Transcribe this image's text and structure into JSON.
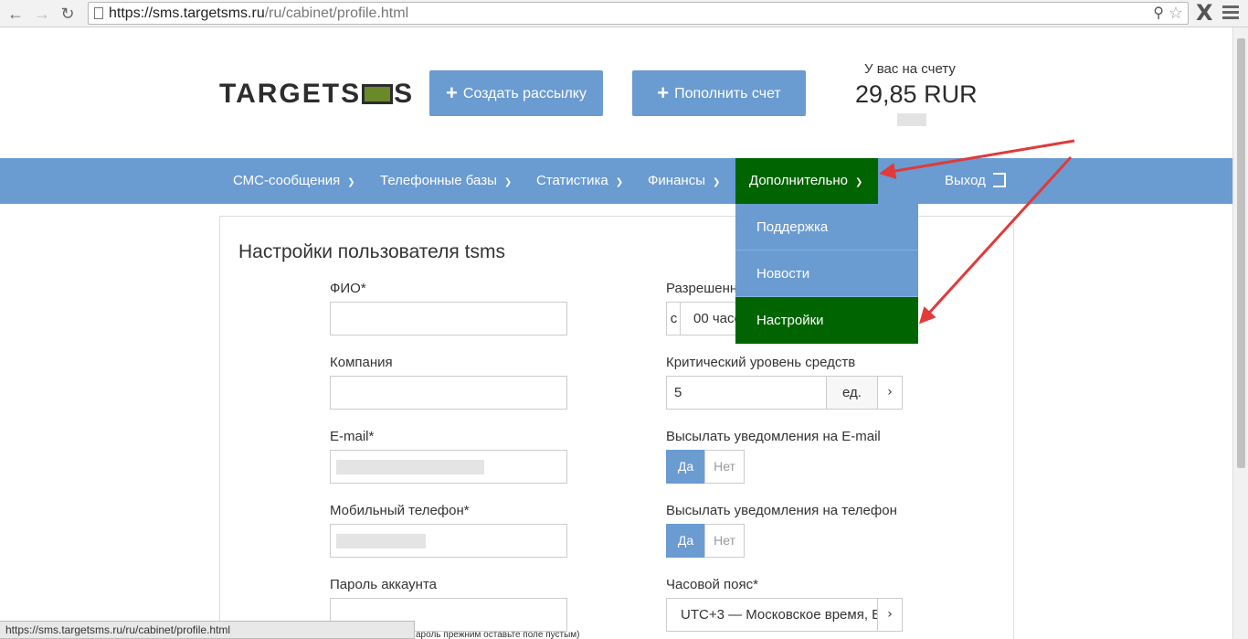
{
  "browser": {
    "url_host": "https://sms.targetsms.ru",
    "url_path": "/ru/cabinet/profile.html",
    "status_url": "https://sms.targetsms.ru/ru/cabinet/profile.html",
    "ext_label": "X"
  },
  "header": {
    "logo_left": "TARGETS",
    "logo_right": "S",
    "create_button": "Создать рассылку",
    "topup_button": "Пополнить счет",
    "balance_label": "У вас на счету",
    "balance_value": "29,85 RUR"
  },
  "navbar": {
    "items": [
      {
        "label": "СМС-сообщения"
      },
      {
        "label": "Телефонные базы"
      },
      {
        "label": "Статистика"
      },
      {
        "label": "Финансы"
      },
      {
        "label": "Дополнительно"
      }
    ],
    "logout": "Выход",
    "active": "Дополнительно"
  },
  "dropdown": {
    "items": [
      {
        "label": "Поддержка"
      },
      {
        "label": "Новости"
      },
      {
        "label": "Настройки"
      }
    ],
    "active": "Настройки"
  },
  "form": {
    "title": "Настройки пользователя tsms",
    "fio_label": "ФИО*",
    "fio_value": "",
    "company_label": "Компания",
    "company_value": "",
    "email_label": "E-mail*",
    "phone_label": "Мобильный телефон*",
    "password_label": "Пароль аккаунта",
    "password_hint": "ароль прежним оставьте поле пустым)",
    "allowed_label": "Разрешенн",
    "allowed_from": "с",
    "allowed_value": "00 часо",
    "critical_label": "Критический уровень средств",
    "critical_value": "5",
    "critical_unit": "ед.",
    "email_notify_label": "Высылать уведомления на E-mail",
    "phone_notify_label": "Высылать уведомления на телефон",
    "yes": "Да",
    "no": "Нет",
    "timezone_label": "Часовой пояс*",
    "timezone_value": "UTC+3 — Московское время, Бе"
  },
  "colors": {
    "accent": "#6a9bd1",
    "active": "#006400",
    "annotation_arrow": "#e03a3a"
  }
}
